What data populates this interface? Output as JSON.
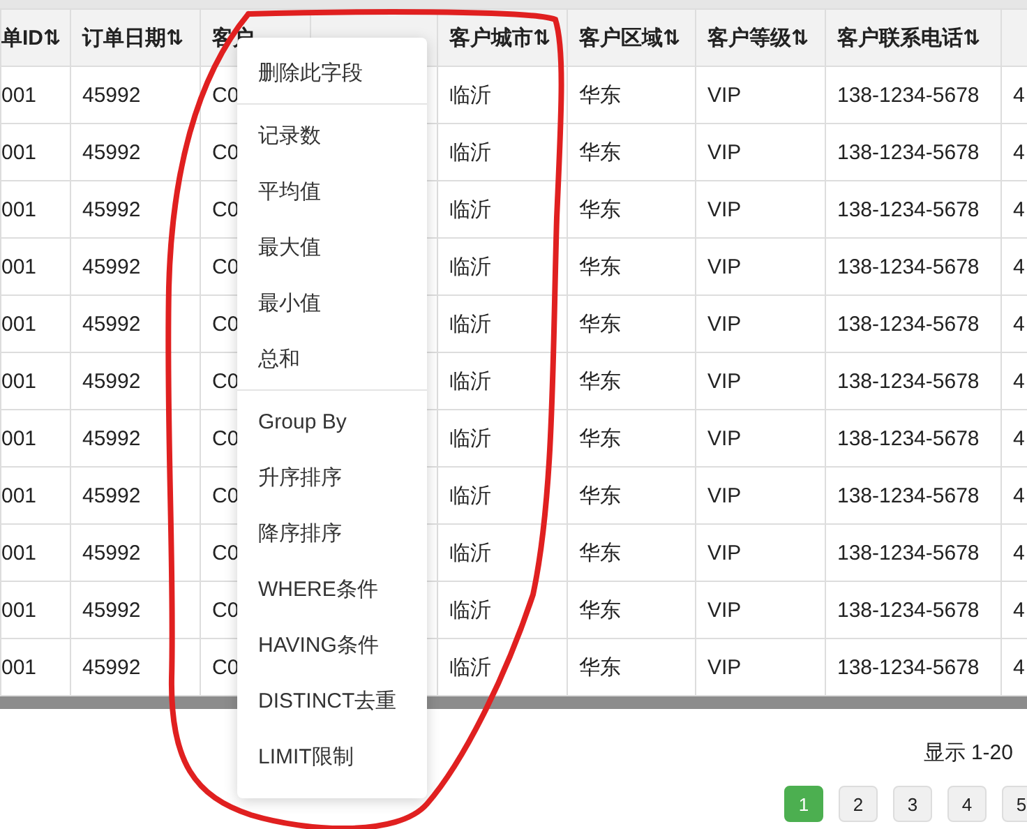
{
  "table": {
    "columns": [
      {
        "label": "单ID⇅"
      },
      {
        "label": "订单日期⇅"
      },
      {
        "label": "客户"
      },
      {},
      {
        "label": "客户城市⇅"
      },
      {
        "label": "客户区域⇅"
      },
      {
        "label": "客户等级⇅"
      },
      {
        "label": "客户联系电话⇅"
      },
      {}
    ],
    "rows": [
      [
        "001",
        "45992",
        "C0",
        null,
        "临沂",
        "华东",
        "VIP",
        "138-1234-5678",
        "4"
      ],
      [
        "001",
        "45992",
        "C0",
        null,
        "临沂",
        "华东",
        "VIP",
        "138-1234-5678",
        "4"
      ],
      [
        "001",
        "45992",
        "C0",
        null,
        "临沂",
        "华东",
        "VIP",
        "138-1234-5678",
        "4"
      ],
      [
        "001",
        "45992",
        "C0",
        null,
        "临沂",
        "华东",
        "VIP",
        "138-1234-5678",
        "4"
      ],
      [
        "001",
        "45992",
        "C0",
        null,
        "临沂",
        "华东",
        "VIP",
        "138-1234-5678",
        "4"
      ],
      [
        "001",
        "45992",
        "C0",
        null,
        "临沂",
        "华东",
        "VIP",
        "138-1234-5678",
        "4"
      ],
      [
        "001",
        "45992",
        "C0",
        null,
        "临沂",
        "华东",
        "VIP",
        "138-1234-5678",
        "4"
      ],
      [
        "001",
        "45992",
        "C0",
        null,
        "临沂",
        "华东",
        "VIP",
        "138-1234-5678",
        "4"
      ],
      [
        "001",
        "45992",
        "C0",
        null,
        "临沂",
        "华东",
        "VIP",
        "138-1234-5678",
        "4"
      ],
      [
        "001",
        "45992",
        "C0",
        null,
        "临沂",
        "华东",
        "VIP",
        "138-1234-5678",
        "4"
      ],
      [
        "001",
        "45992",
        "C0",
        null,
        "临沂",
        "华东",
        "VIP",
        "138-1234-5678",
        "4"
      ]
    ]
  },
  "context_menu": {
    "groups": [
      [
        "删除此字段"
      ],
      [
        "记录数",
        "平均值",
        "最大值",
        "最小值",
        "总和"
      ],
      [
        "Group By",
        "升序排序",
        "降序排序",
        "WHERE条件",
        "HAVING条件",
        "DISTINCT去重",
        "LIMIT限制"
      ]
    ]
  },
  "pagination": {
    "summary": "显示 1-20",
    "pages": [
      {
        "label": "1",
        "selected": true
      },
      {
        "label": "2",
        "selected": false
      },
      {
        "label": "3",
        "selected": false
      },
      {
        "label": "4",
        "selected": false
      },
      {
        "label": "5",
        "selected": false
      }
    ]
  }
}
